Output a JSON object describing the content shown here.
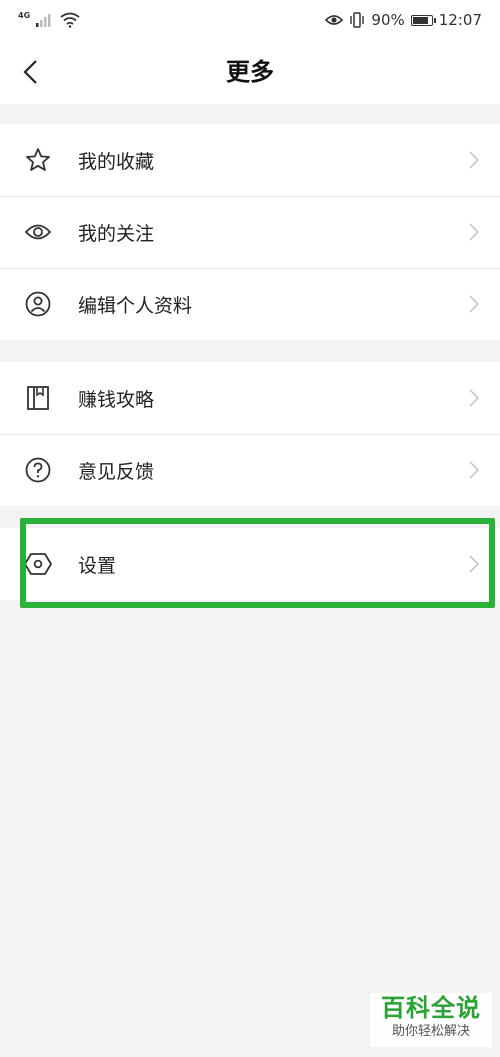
{
  "status_bar": {
    "network_badge": "4G",
    "battery_percent": "90%",
    "battery_level": 0.9,
    "time": "12:07",
    "icons": [
      "signal-icon",
      "wifi-icon",
      "eye-care-icon",
      "vibrate-icon",
      "battery-icon"
    ]
  },
  "header": {
    "title": "更多",
    "back_icon": "back-arrow-icon"
  },
  "menu": {
    "group1": [
      {
        "label": "我的收藏",
        "icon": "star-icon"
      },
      {
        "label": "我的关注",
        "icon": "eye-icon"
      },
      {
        "label": "编辑个人资料",
        "icon": "profile-icon"
      }
    ],
    "group2": [
      {
        "label": "赚钱攻略",
        "icon": "book-icon"
      },
      {
        "label": "意见反馈",
        "icon": "question-icon"
      }
    ],
    "group3": [
      {
        "label": "设置",
        "icon": "settings-icon"
      }
    ]
  },
  "highlight_color": "#2bb13a",
  "watermark": {
    "title": "百科全说",
    "subtitle": "助你轻松解决"
  }
}
